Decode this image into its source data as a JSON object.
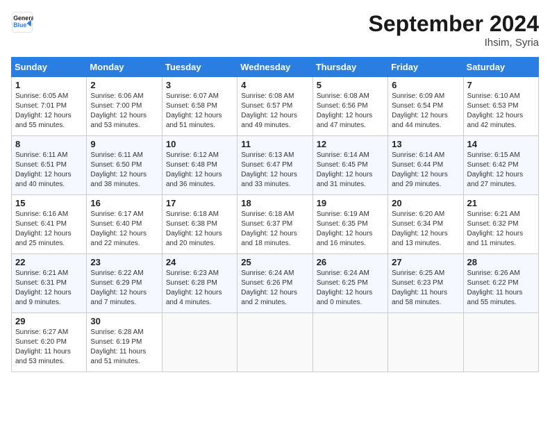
{
  "header": {
    "logo_line1": "General",
    "logo_line2": "Blue",
    "month": "September 2024",
    "location": "Ihsim, Syria"
  },
  "weekdays": [
    "Sunday",
    "Monday",
    "Tuesday",
    "Wednesday",
    "Thursday",
    "Friday",
    "Saturday"
  ],
  "weeks": [
    [
      {
        "day": "1",
        "sunrise": "6:05 AM",
        "sunset": "7:01 PM",
        "daylight": "12 hours and 55 minutes."
      },
      {
        "day": "2",
        "sunrise": "6:06 AM",
        "sunset": "7:00 PM",
        "daylight": "12 hours and 53 minutes."
      },
      {
        "day": "3",
        "sunrise": "6:07 AM",
        "sunset": "6:58 PM",
        "daylight": "12 hours and 51 minutes."
      },
      {
        "day": "4",
        "sunrise": "6:08 AM",
        "sunset": "6:57 PM",
        "daylight": "12 hours and 49 minutes."
      },
      {
        "day": "5",
        "sunrise": "6:08 AM",
        "sunset": "6:56 PM",
        "daylight": "12 hours and 47 minutes."
      },
      {
        "day": "6",
        "sunrise": "6:09 AM",
        "sunset": "6:54 PM",
        "daylight": "12 hours and 44 minutes."
      },
      {
        "day": "7",
        "sunrise": "6:10 AM",
        "sunset": "6:53 PM",
        "daylight": "12 hours and 42 minutes."
      }
    ],
    [
      {
        "day": "8",
        "sunrise": "6:11 AM",
        "sunset": "6:51 PM",
        "daylight": "12 hours and 40 minutes."
      },
      {
        "day": "9",
        "sunrise": "6:11 AM",
        "sunset": "6:50 PM",
        "daylight": "12 hours and 38 minutes."
      },
      {
        "day": "10",
        "sunrise": "6:12 AM",
        "sunset": "6:48 PM",
        "daylight": "12 hours and 36 minutes."
      },
      {
        "day": "11",
        "sunrise": "6:13 AM",
        "sunset": "6:47 PM",
        "daylight": "12 hours and 33 minutes."
      },
      {
        "day": "12",
        "sunrise": "6:14 AM",
        "sunset": "6:45 PM",
        "daylight": "12 hours and 31 minutes."
      },
      {
        "day": "13",
        "sunrise": "6:14 AM",
        "sunset": "6:44 PM",
        "daylight": "12 hours and 29 minutes."
      },
      {
        "day": "14",
        "sunrise": "6:15 AM",
        "sunset": "6:42 PM",
        "daylight": "12 hours and 27 minutes."
      }
    ],
    [
      {
        "day": "15",
        "sunrise": "6:16 AM",
        "sunset": "6:41 PM",
        "daylight": "12 hours and 25 minutes."
      },
      {
        "day": "16",
        "sunrise": "6:17 AM",
        "sunset": "6:40 PM",
        "daylight": "12 hours and 22 minutes."
      },
      {
        "day": "17",
        "sunrise": "6:18 AM",
        "sunset": "6:38 PM",
        "daylight": "12 hours and 20 minutes."
      },
      {
        "day": "18",
        "sunrise": "6:18 AM",
        "sunset": "6:37 PM",
        "daylight": "12 hours and 18 minutes."
      },
      {
        "day": "19",
        "sunrise": "6:19 AM",
        "sunset": "6:35 PM",
        "daylight": "12 hours and 16 minutes."
      },
      {
        "day": "20",
        "sunrise": "6:20 AM",
        "sunset": "6:34 PM",
        "daylight": "12 hours and 13 minutes."
      },
      {
        "day": "21",
        "sunrise": "6:21 AM",
        "sunset": "6:32 PM",
        "daylight": "12 hours and 11 minutes."
      }
    ],
    [
      {
        "day": "22",
        "sunrise": "6:21 AM",
        "sunset": "6:31 PM",
        "daylight": "12 hours and 9 minutes."
      },
      {
        "day": "23",
        "sunrise": "6:22 AM",
        "sunset": "6:29 PM",
        "daylight": "12 hours and 7 minutes."
      },
      {
        "day": "24",
        "sunrise": "6:23 AM",
        "sunset": "6:28 PM",
        "daylight": "12 hours and 4 minutes."
      },
      {
        "day": "25",
        "sunrise": "6:24 AM",
        "sunset": "6:26 PM",
        "daylight": "12 hours and 2 minutes."
      },
      {
        "day": "26",
        "sunrise": "6:24 AM",
        "sunset": "6:25 PM",
        "daylight": "12 hours and 0 minutes."
      },
      {
        "day": "27",
        "sunrise": "6:25 AM",
        "sunset": "6:23 PM",
        "daylight": "11 hours and 58 minutes."
      },
      {
        "day": "28",
        "sunrise": "6:26 AM",
        "sunset": "6:22 PM",
        "daylight": "11 hours and 55 minutes."
      }
    ],
    [
      {
        "day": "29",
        "sunrise": "6:27 AM",
        "sunset": "6:20 PM",
        "daylight": "11 hours and 53 minutes."
      },
      {
        "day": "30",
        "sunrise": "6:28 AM",
        "sunset": "6:19 PM",
        "daylight": "11 hours and 51 minutes."
      },
      null,
      null,
      null,
      null,
      null
    ]
  ]
}
